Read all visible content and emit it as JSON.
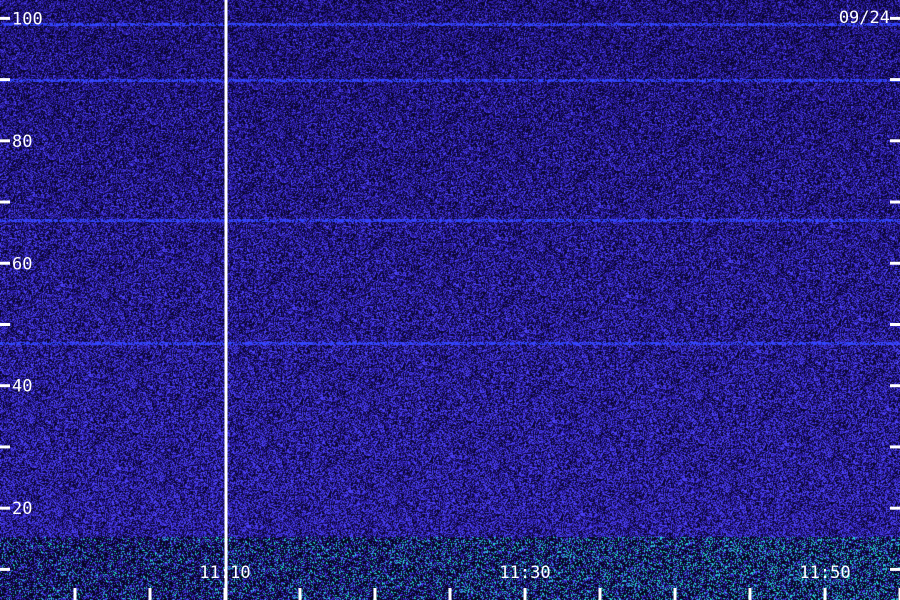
{
  "chart_data": {
    "type": "heatmap",
    "date_label": "09/24",
    "y_ticks": [
      {
        "value": 100,
        "label": "100"
      },
      {
        "value": 90,
        "label": ""
      },
      {
        "value": 80,
        "label": "80"
      },
      {
        "value": 70,
        "label": ""
      },
      {
        "value": 60,
        "label": "60"
      },
      {
        "value": 50,
        "label": ""
      },
      {
        "value": 40,
        "label": "40"
      },
      {
        "value": 30,
        "label": ""
      },
      {
        "value": 20,
        "label": "20"
      },
      {
        "value": 10,
        "label": ""
      }
    ],
    "x_ticks": [
      {
        "value": 0,
        "label": ""
      },
      {
        "value": 5,
        "label": ""
      },
      {
        "value": 10,
        "label": "11:10"
      },
      {
        "value": 15,
        "label": ""
      },
      {
        "value": 20,
        "label": ""
      },
      {
        "value": 25,
        "label": ""
      },
      {
        "value": 30,
        "label": "11:30"
      },
      {
        "value": 35,
        "label": ""
      },
      {
        "value": 40,
        "label": ""
      },
      {
        "value": 45,
        "label": ""
      },
      {
        "value": 50,
        "label": "11:50"
      },
      {
        "value": 55,
        "label": ""
      }
    ],
    "y_range": [
      5,
      103
    ],
    "x_range": [
      -5,
      55
    ],
    "marker_line_x": 10,
    "horizontal_bands": [
      99,
      90,
      67,
      47
    ],
    "colors": {
      "background": "#1a0a5e",
      "noise_low": "#0a0520",
      "noise_mid": "#2a1aa8",
      "noise_high": "#4030e0",
      "band": "#3a40ff",
      "signal_cyan": "#30e0d0",
      "signal_green": "#60ff60",
      "axis": "#ffffff"
    }
  }
}
